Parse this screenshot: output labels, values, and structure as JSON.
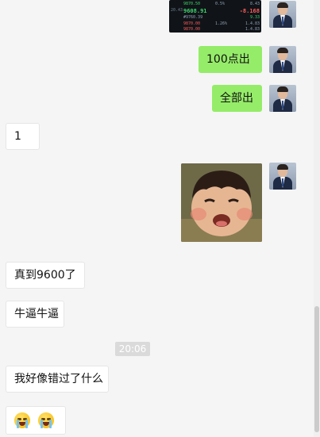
{
  "messages": {
    "sent_1": {
      "text": "100点出"
    },
    "sent_2": {
      "text": "全部出"
    },
    "recv_1": {
      "text": "1"
    },
    "recv_2": {
      "text": "真到9600了"
    },
    "recv_3": {
      "text": "牛逼牛逼"
    },
    "recv_4": {
      "text": "我好像错过了什么"
    },
    "recv_5": {
      "emojis": [
        "crying-face",
        "crying-face"
      ]
    }
  },
  "timestamp": "20:06",
  "stock_screenshot": {
    "rows": [
      {
        "a": "9870.50",
        "b": "0.5%",
        "c": "8.43"
      },
      {
        "a": "9608.91",
        "b": "",
        "c": "-8.168"
      },
      {
        "a": "#9760.39",
        "b": "",
        "c": "9.33"
      },
      {
        "a": "9870.00",
        "b": "1.26%",
        "c": "1.4.83"
      },
      {
        "a": "9870.00",
        "b": "",
        "c": "1.4.83"
      }
    ],
    "side_label": "20.43"
  },
  "colors": {
    "sent_bubble": "#95ec69",
    "received_bubble": "#ffffff",
    "chat_background": "#f5f5f5",
    "timestamp_chip": "#dadada"
  },
  "icons": {
    "avatar": "user-avatar",
    "emoji": "crying-face-emoji"
  },
  "scroll": {
    "thumb_start": 0.7,
    "thumb_fraction": 0.3
  }
}
